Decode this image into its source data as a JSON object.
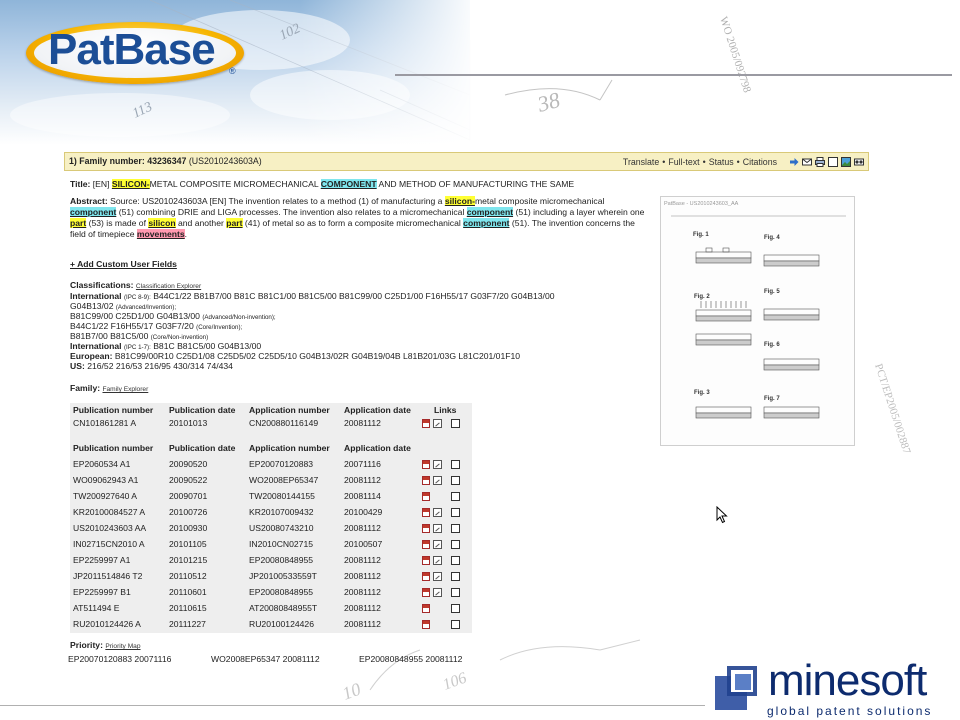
{
  "brand": {
    "patbase_logo": "PatBase",
    "patbase_reg": "®",
    "minesoft_logo_main": "mine",
    "minesoft_logo_accent": "soft",
    "minesoft_tagline": "global patent solutions"
  },
  "result": {
    "index_label": "1) Family number:",
    "family_number": "43236347",
    "family_pub": "(US2010243603A)",
    "actions": [
      "Translate",
      "Full-text",
      "Status",
      "Citations"
    ],
    "toolbar_icons": [
      "arrow-right-icon",
      "email-icon",
      "print-icon",
      "checkbox-icon",
      "image-icon",
      "binoculars-icon"
    ]
  },
  "title": {
    "label": "Title:",
    "prefix": "[EN]",
    "hl1": "SILICON-",
    "mid": "METAL COMPOSITE MICROMECHANICAL",
    "hl2": "COMPONENT",
    "suffix": "AND METHOD OF MANUFACTURING THE SAME"
  },
  "abstract": {
    "label": "Abstract:",
    "t1": "Source: US2010243603A [EN] The invention relates to a method (1) of manufacturing a",
    "h1": "silicon-",
    "t2": "metal composite micromechanical",
    "h2": "component",
    "t3": "(51) combining DRIE and LIGA processes. The invention also relates to a micromechanical",
    "h3": "component",
    "t4": "(51) including a layer wherein one",
    "h4": "part",
    "t5": "(53) is made of",
    "h5": "silicon",
    "t6": "and another",
    "h6": "part",
    "t7": "(41) of metal so as to form a composite micromechanical",
    "h7": "component",
    "t8": "(51). The invention concerns the field of timepiece",
    "h8": "movements",
    "t9": "."
  },
  "custom_fields_link": "+ Add Custom User Fields",
  "classifications": {
    "label": "Classifications:",
    "explorer_link": "Classification Explorer",
    "intl_label": "International",
    "intl_note": "(IPC 8-9):",
    "intl_line1": "B44C1/22 B81B7/00 B81C B81C1/00 B81C5/00 B81C99/00 C25D1/00 F16H55/17 G03F7/20 G04B13/00",
    "intl_line2": "G04B13/02",
    "intl_line2_note": "(Advanced/Invention);",
    "intl_line3": "B81C99/00 C25D1/00 G04B13/00",
    "intl_line3_note": "(Advanced/Non-invention);",
    "intl_line4": "B44C1/22 F16H55/17 G03F7/20",
    "intl_line4_note": "(Core/Invention);",
    "intl_line5": "B81B7/00 B81C5/00",
    "intl_line5_note": "(Core/Non-invention)",
    "intl2_label": "International",
    "intl2_note": "(IPC 1-7):",
    "intl2_value": "B81C B81C5/00 G04B13/00",
    "euro_label": "European:",
    "euro_value": "B81C99/00R10 C25D1/08 C25D5/02 C25D5/10 G04B13/02R G04B19/04B L81B201/03G L81C201/01F10",
    "us_label": "US:",
    "us_value": "216/52 216/53 216/95 430/314 74/434"
  },
  "family": {
    "label": "Family:",
    "explorer_link": "Family Explorer",
    "headers": [
      "Publication number",
      "Publication date",
      "Application number",
      "Application date",
      "Links"
    ],
    "first_row": {
      "pub": "CN101861281 A",
      "pub_date": "20101013",
      "app": "CN200880116149",
      "app_date": "20081112"
    },
    "headers2": [
      "Publication number",
      "Publication date",
      "Application number",
      "Application date"
    ],
    "rows": [
      {
        "pub": "EP2060534 A1",
        "pub_date": "20090520",
        "app": "EP20070120883",
        "app_date": "20071116"
      },
      {
        "pub": "WO09062943 A1",
        "pub_date": "20090522",
        "app": "WO2008EP65347",
        "app_date": "20081112"
      },
      {
        "pub": "TW200927640 A",
        "pub_date": "20090701",
        "app": "TW20080144155",
        "app_date": "20081114"
      },
      {
        "pub": "KR20100084527 A",
        "pub_date": "20100726",
        "app": "KR20107009432",
        "app_date": "20100429"
      },
      {
        "pub": "US2010243603 AA",
        "pub_date": "20100930",
        "app": "US20080743210",
        "app_date": "20081112"
      },
      {
        "pub": "IN02715CN2010 A",
        "pub_date": "20101105",
        "app": "IN2010CN02715",
        "app_date": "20100507"
      },
      {
        "pub": "EP2259997 A1",
        "pub_date": "20101215",
        "app": "EP20080848955",
        "app_date": "20081112"
      },
      {
        "pub": "JP2011514846 T2",
        "pub_date": "20110512",
        "app": "JP20100533559T",
        "app_date": "20081112"
      },
      {
        "pub": "EP2259997 B1",
        "pub_date": "20110601",
        "app": "EP20080848955",
        "app_date": "20081112"
      },
      {
        "pub": "AT511494 E",
        "pub_date": "20110615",
        "app": "AT20080848955T",
        "app_date": "20081112"
      },
      {
        "pub": "RU2010124426 A",
        "pub_date": "20111227",
        "app": "RU20100124426",
        "app_date": "20081112"
      }
    ]
  },
  "priority": {
    "label": "Priority:",
    "map_link": "Priority Map",
    "values": [
      "EP20070120883 20071116",
      "WO2008EP65347 20081112",
      "EP20080848955 20081112"
    ]
  },
  "drawing": {
    "caption": "PatBase - US2010243603_AA",
    "figures": [
      "Fig. 1",
      "Fig. 2",
      "Fig. 3",
      "Fig. 4",
      "Fig. 5",
      "Fig. 6",
      "Fig. 7"
    ]
  },
  "background_text": [
    "WO 2005/092798",
    "PCT/EP2005/002887",
    "102",
    "38",
    "10",
    "106",
    "113"
  ]
}
